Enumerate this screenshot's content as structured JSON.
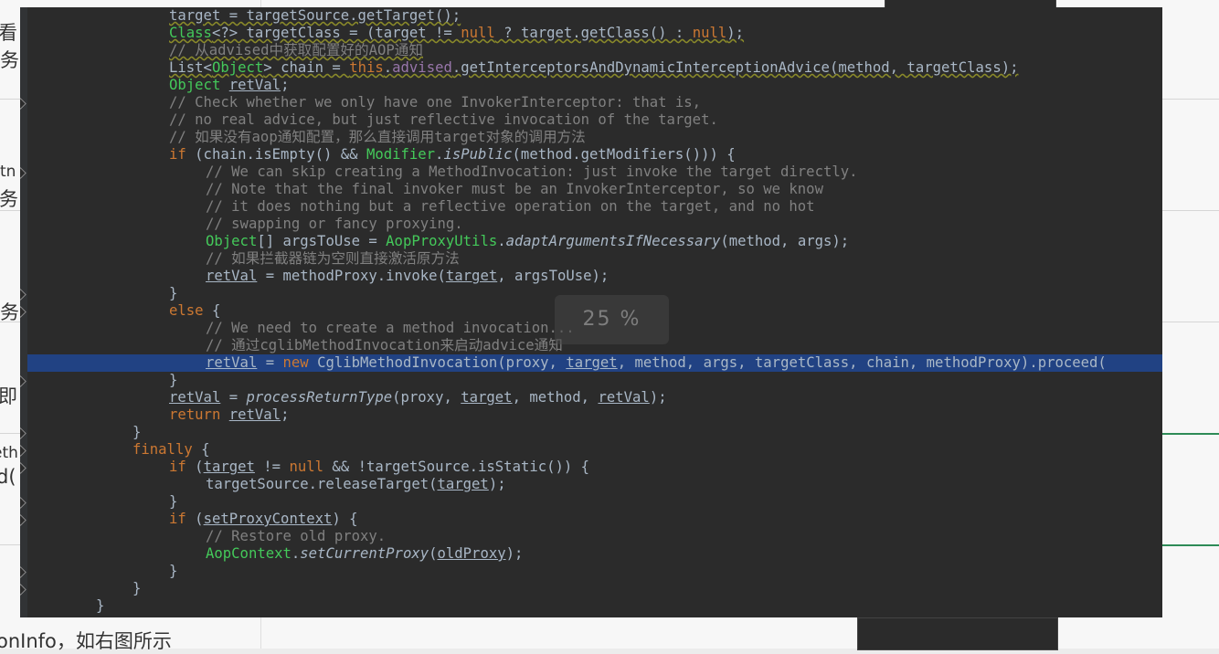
{
  "background_doc": {
    "fragments": [
      "看",
      "务",
      "tn",
      "事务",
      "务",
      "即",
      "eth",
      "d(",
      "onInfo，如右图所示"
    ]
  },
  "editor": {
    "zoom_label": "25 %",
    "lines": [
      [
        [
          "",
          "target = targetSource.getTarget();"
        ]
      ],
      [
        [
          "cls",
          "Class"
        ],
        [
          "",
          "<?> targetClass = (target != "
        ],
        [
          "kw",
          "null"
        ],
        [
          "",
          " ? target.getClass() : "
        ],
        [
          "kw",
          "null"
        ],
        [
          "",
          ");"
        ]
      ],
      [
        [
          "cm",
          "// 从advised中获取配置好的AOP通知"
        ]
      ],
      [
        [
          "",
          "List<"
        ],
        [
          "cls",
          "Object"
        ],
        [
          "",
          "> chain = "
        ],
        [
          "kw",
          "this"
        ],
        [
          "",
          "."
        ],
        [
          "fld",
          "advised"
        ],
        [
          "",
          ".getInterceptorsAndDynamicInterceptionAdvice(method, targetClass);"
        ]
      ],
      [
        [
          "cls",
          "Object"
        ],
        [
          "",
          " "
        ],
        [
          "ul",
          "retVal"
        ],
        [
          "",
          ";"
        ]
      ],
      [
        [
          "cm",
          "// Check whether we only have one InvokerInterceptor: that is,"
        ]
      ],
      [
        [
          "cm",
          "// no real advice, but just reflective invocation of the target."
        ]
      ],
      [
        [
          "cm",
          "// 如果没有aop通知配置，那么直接调用target对象的调用方法"
        ]
      ],
      [
        [
          "kw",
          "if"
        ],
        [
          "",
          " (chain.isEmpty() && "
        ],
        [
          "cls",
          "Modifier"
        ],
        [
          "",
          "."
        ],
        [
          "it",
          "isPublic"
        ],
        [
          "",
          "(method.getModifiers())) {"
        ]
      ],
      [
        [
          "cm",
          "// We can skip creating a MethodInvocation: just invoke the target directly."
        ]
      ],
      [
        [
          "cm",
          "// Note that the final invoker must be an InvokerInterceptor, so we know"
        ]
      ],
      [
        [
          "cm",
          "// it does nothing but a reflective operation on the target, and no hot"
        ]
      ],
      [
        [
          "cm",
          "// swapping or fancy proxying."
        ]
      ],
      [
        [
          "cls",
          "Object"
        ],
        [
          "",
          "[] argsToUse = "
        ],
        [
          "cls",
          "AopProxyUtils"
        ],
        [
          "",
          "."
        ],
        [
          "it",
          "adaptArgumentsIfNecessary"
        ],
        [
          "",
          "(method, args);"
        ]
      ],
      [
        [
          "cm",
          "// 如果拦截器链为空则直接激活原方法"
        ]
      ],
      [
        [
          "ul",
          "retVal"
        ],
        [
          "",
          " = methodProxy.invoke("
        ],
        [
          "ul",
          "target"
        ],
        [
          "",
          ", argsToUse);"
        ]
      ],
      [
        [
          "",
          "}"
        ]
      ],
      [
        [
          "kw",
          "else"
        ],
        [
          "",
          " {"
        ]
      ],
      [
        [
          "cm",
          "// We need to create a method invocation..."
        ]
      ],
      [
        [
          "cm",
          "// 通过cglibMethodInvocation来启动advice通知"
        ]
      ],
      [
        [
          "ul",
          "retVal"
        ],
        [
          "",
          " = "
        ],
        [
          "kw",
          "new"
        ],
        [
          "",
          " CglibMethodInvocation(proxy, "
        ],
        [
          "ul",
          "target"
        ],
        [
          "",
          ", method, args, targetClass, chain, methodProxy).proceed("
        ]
      ],
      [
        [
          "",
          "}"
        ]
      ],
      [
        [
          "ul",
          "retVal"
        ],
        [
          "",
          " = "
        ],
        [
          "it",
          "processReturnType"
        ],
        [
          "",
          "(proxy, "
        ],
        [
          "ul",
          "target"
        ],
        [
          "",
          ", method, "
        ],
        [
          "ul",
          "retVal"
        ],
        [
          "",
          ");"
        ]
      ],
      [
        [
          "kw",
          "return"
        ],
        [
          "",
          " "
        ],
        [
          "ul",
          "retVal"
        ],
        [
          "",
          ";"
        ]
      ],
      [
        [
          "",
          "}"
        ]
      ],
      [
        [
          "kw",
          "finally"
        ],
        [
          "",
          " {"
        ]
      ],
      [
        [
          "kw",
          "if"
        ],
        [
          "",
          " ("
        ],
        [
          "ul",
          "target"
        ],
        [
          "",
          " != "
        ],
        [
          "kw",
          "null"
        ],
        [
          "",
          " && !targetSource.isStatic()) {"
        ]
      ],
      [
        [
          "",
          "targetSource.releaseTarget("
        ],
        [
          "ul",
          "target"
        ],
        [
          "",
          ");"
        ]
      ],
      [
        [
          "",
          "}"
        ]
      ],
      [
        [
          "kw",
          "if"
        ],
        [
          "",
          " ("
        ],
        [
          "ul",
          "setProxyContext"
        ],
        [
          "",
          ") {"
        ]
      ],
      [
        [
          "cm",
          "// Restore old proxy."
        ]
      ],
      [
        [
          "cls",
          "AopContext"
        ],
        [
          "",
          "."
        ],
        [
          "it",
          "setCurrentProxy"
        ],
        [
          "",
          "("
        ],
        [
          "ul",
          "oldProxy"
        ],
        [
          "",
          ");"
        ]
      ],
      [
        [
          "",
          "}"
        ]
      ],
      [
        [
          "",
          "}"
        ]
      ],
      [
        [
          "",
          "}"
        ]
      ]
    ]
  }
}
